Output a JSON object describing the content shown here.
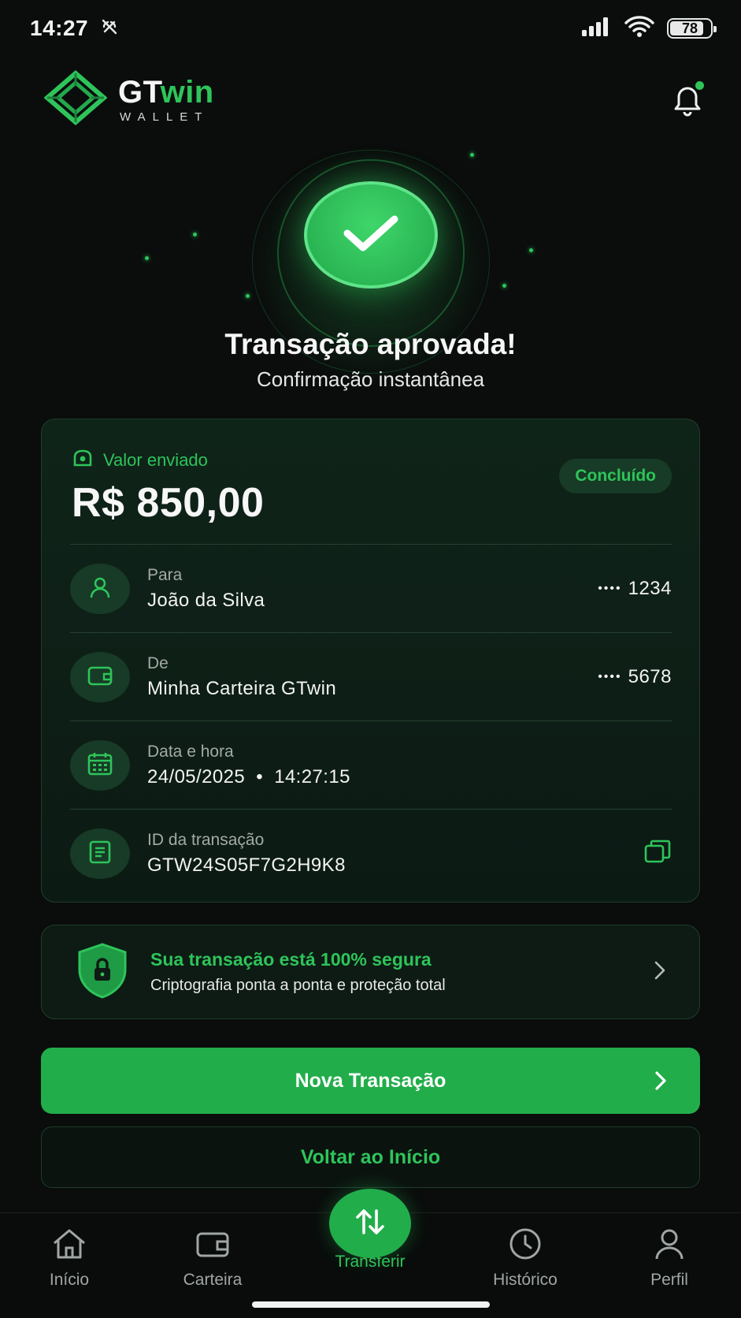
{
  "status_bar": {
    "time": "14:27",
    "battery": "78"
  },
  "header": {
    "brand_main": "GT",
    "brand_accent": "win",
    "brand_sub": "WALLET"
  },
  "hero": {
    "title": "Transação aprovada!",
    "subtitle": "Confirmação instantânea"
  },
  "transaction": {
    "amount_label": "Valor enviado",
    "amount": "R$ 850,00",
    "status": "Concluído",
    "rows": [
      {
        "label": "Para",
        "value": "João da Silva",
        "mask": "••••",
        "suffix": "1234",
        "icon": "user-icon"
      },
      {
        "label": "De",
        "value": "Minha Carteira GTwin",
        "mask": "••••",
        "suffix": "5678",
        "icon": "wallet-icon"
      },
      {
        "label": "Data e hora",
        "value": "24/05/2025  •  14:27:15",
        "icon": "calendar-icon"
      },
      {
        "label": "ID da transação",
        "value": "GTW24S05F7G2H9K8",
        "icon": "receipt-icon"
      }
    ]
  },
  "security": {
    "title": "Sua transação está 100% segura",
    "subtitle": "Criptografia ponta a ponta e proteção total"
  },
  "buttons": {
    "primary": "Nova Transação",
    "secondary": "Voltar ao Início"
  },
  "nav": [
    {
      "label": "Início",
      "icon": "home-icon"
    },
    {
      "label": "Carteira",
      "icon": "wallet-icon"
    },
    {
      "label": "Transferir",
      "icon": "transfer-icon",
      "active": true
    },
    {
      "label": "Histórico",
      "icon": "clock-icon"
    },
    {
      "label": "Perfil",
      "icon": "user-icon"
    }
  ],
  "colors": {
    "accent": "#2ec45a",
    "background": "#0a0d0c",
    "card": "#0f2419"
  }
}
